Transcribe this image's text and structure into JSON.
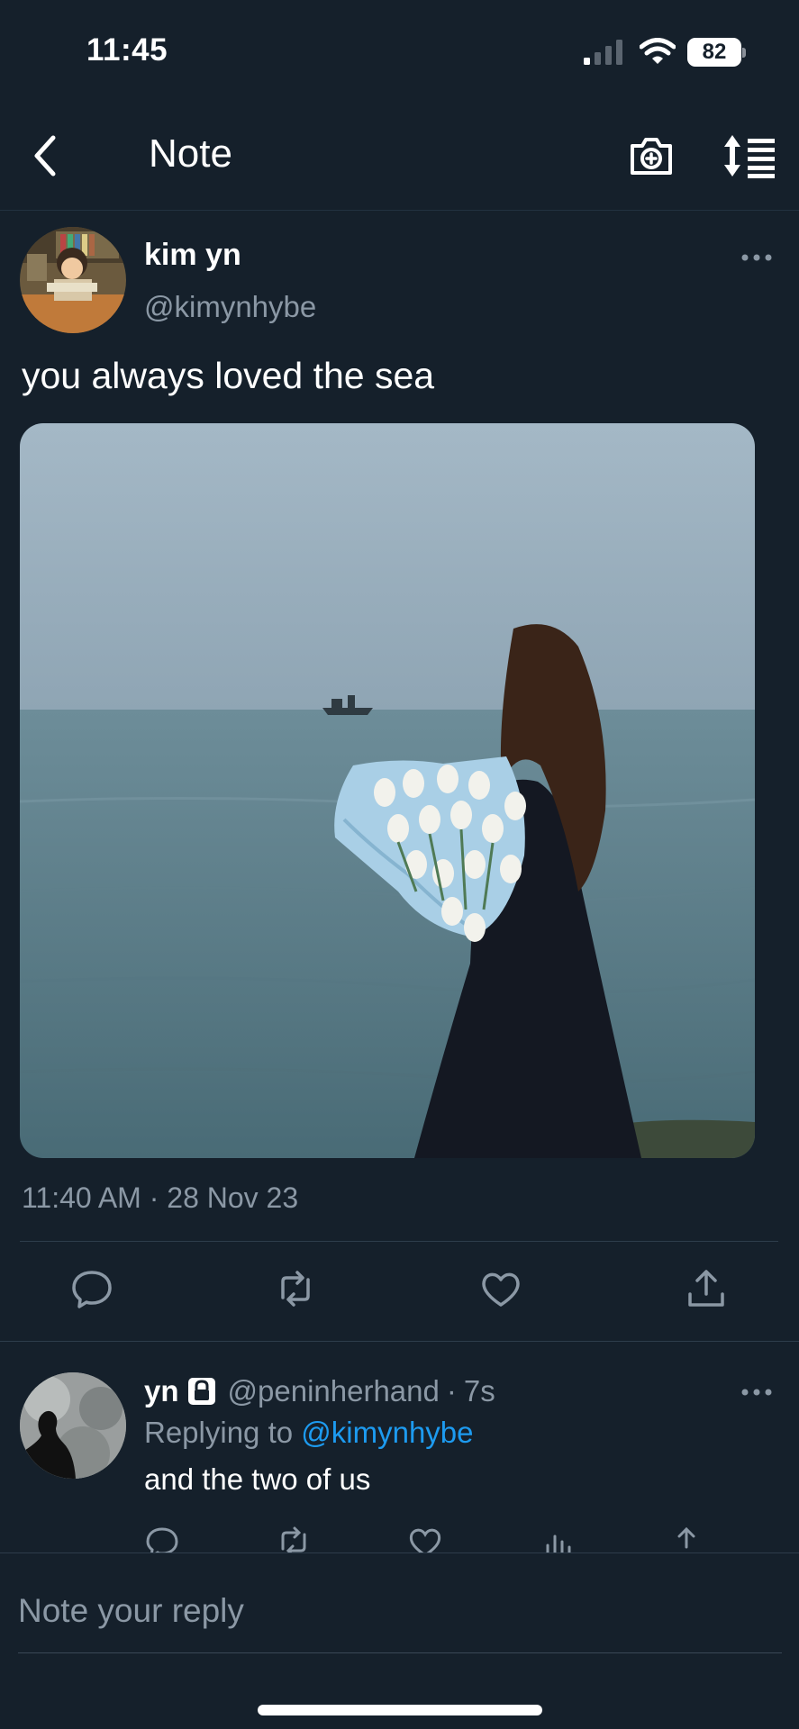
{
  "status_bar": {
    "time": "11:45",
    "battery": "82"
  },
  "header": {
    "title": "Note"
  },
  "note": {
    "author_name": "kim yn",
    "author_handle": "@kimynhybe",
    "text": "you always loved the sea",
    "timestamp": "11:40 AM · 28 Nov 23"
  },
  "reply": {
    "author_name": "yn",
    "handle": "@peninherhand",
    "separator": "·",
    "time_ago": "7s",
    "replying_prefix": "Replying to",
    "replying_to": "@kimynhybe",
    "text": "and the two of us"
  },
  "compose": {
    "placeholder": "Note your reply"
  },
  "colors": {
    "background": "#15202b",
    "secondary_text": "#8b98a5",
    "accent": "#1d9bf0",
    "divider": "#2d3c4b"
  },
  "icons": [
    "back-chevron-icon",
    "add-photo-icon",
    "sort-icon",
    "more-icon",
    "reply-icon",
    "repost-icon",
    "like-icon",
    "share-icon",
    "lock-icon",
    "views-icon"
  ]
}
